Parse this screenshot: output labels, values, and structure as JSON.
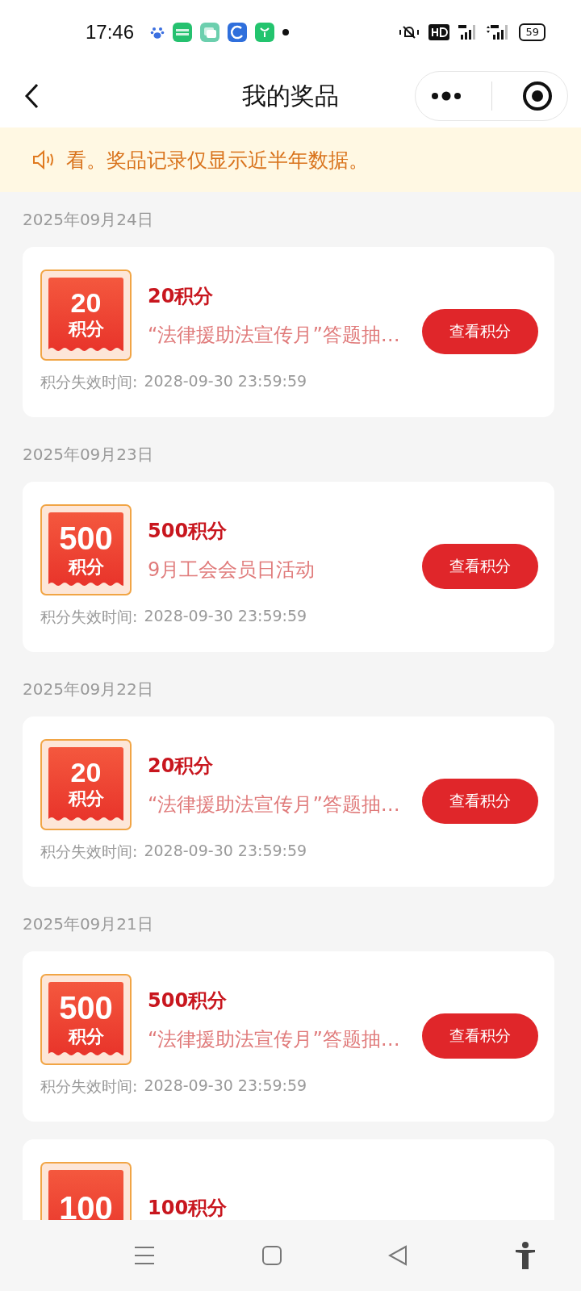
{
  "status_bar": {
    "time": "17:46",
    "battery": "59"
  },
  "header": {
    "title": "我的奖品"
  },
  "notice": {
    "text": "看。奖品记录仅显示近半年数据。"
  },
  "groups": [
    {
      "date": "2025年09月24日",
      "prize": {
        "amount": "20",
        "unit": "积分",
        "title": "20积分",
        "source": "“法律援助法宣传月”答题抽…",
        "expiry_label": "积分失效时间:",
        "expiry": "2028-09-30 23:59:59",
        "button": "查看积分"
      }
    },
    {
      "date": "2025年09月23日",
      "prize": {
        "amount": "500",
        "unit": "积分",
        "title": "500积分",
        "source": "9月工会会员日活动",
        "expiry_label": "积分失效时间:",
        "expiry": "2028-09-30 23:59:59",
        "button": "查看积分"
      }
    },
    {
      "date": "2025年09月22日",
      "prize": {
        "amount": "20",
        "unit": "积分",
        "title": "20积分",
        "source": "“法律援助法宣传月”答题抽…",
        "expiry_label": "积分失效时间:",
        "expiry": "2028-09-30 23:59:59",
        "button": "查看积分"
      }
    },
    {
      "date": "2025年09月21日",
      "prize": {
        "amount": "500",
        "unit": "积分",
        "title": "500积分",
        "source": "“法律援助法宣传月”答题抽…",
        "expiry_label": "积分失效时间:",
        "expiry": "2028-09-30 23:59:59",
        "button": "查看积分"
      }
    },
    {
      "prize": {
        "amount": "100",
        "title": "100积分"
      }
    }
  ]
}
